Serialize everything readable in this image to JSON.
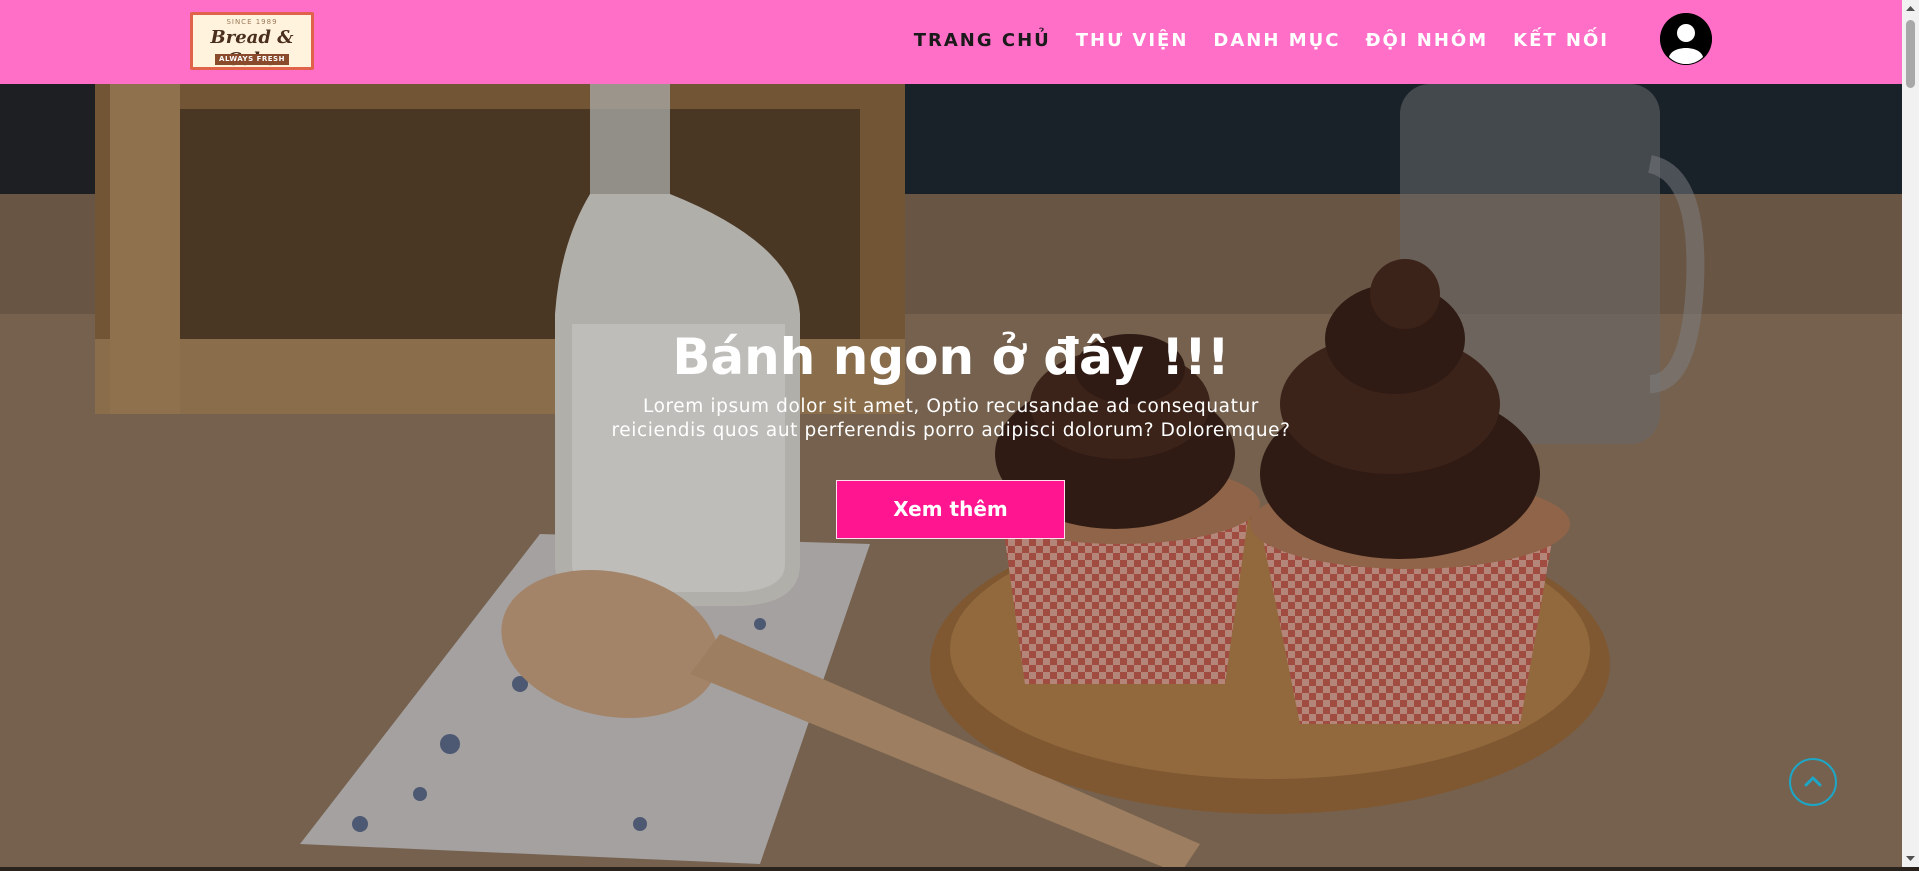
{
  "brand": {
    "since": "SINCE 1989",
    "name": "Bread & Cake",
    "tagline": "ALWAYS FRESH"
  },
  "nav": {
    "items": [
      {
        "label": "TRANG CHỦ",
        "active": true
      },
      {
        "label": "THƯ VIỆN",
        "active": false
      },
      {
        "label": "DANH MỤC",
        "active": false
      },
      {
        "label": "ĐỘI NHÓM",
        "active": false
      },
      {
        "label": "KẾT NỐI",
        "active": false
      }
    ],
    "avatar_icon": "user-circle-icon"
  },
  "hero": {
    "title": "Bánh ngon ở đây !!!",
    "description": "Lorem ipsum dolor sit amet, Optio recusandae ad consequatur reiciendis quos aut perferendis porro adipisci dolorum? Doloremque?",
    "button_label": "Xem thêm",
    "background_icon": "cupcakes-and-milk-photo"
  },
  "back_to_top": {
    "icon": "chevron-up-icon"
  },
  "colors": {
    "navbar": "#ff6fc8",
    "active_nav": "#1a1a1a",
    "nav_text": "#ffffff",
    "button": "#ff1590",
    "back_to_top_border": "#1ea6c6"
  }
}
